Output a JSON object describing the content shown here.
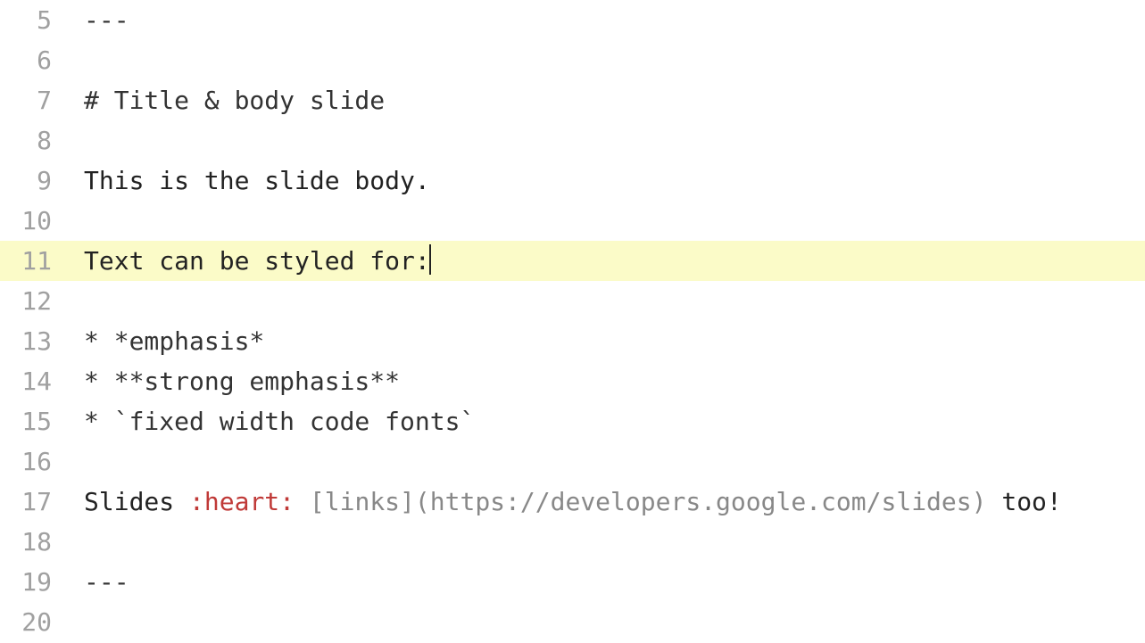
{
  "active_line_index": 6,
  "cursor_at": 6,
  "lines": [
    {
      "n": 5,
      "segs": [
        {
          "t": "---",
          "cls": "tk-punc"
        }
      ]
    },
    {
      "n": 6,
      "segs": []
    },
    {
      "n": 7,
      "segs": [
        {
          "t": "# Title & body slide",
          "cls": "tk-punc"
        }
      ]
    },
    {
      "n": 8,
      "segs": []
    },
    {
      "n": 9,
      "segs": [
        {
          "t": "This is the slide body.",
          "cls": ""
        }
      ]
    },
    {
      "n": 10,
      "segs": []
    },
    {
      "n": 11,
      "segs": [
        {
          "t": "Text can be styled for:",
          "cls": ""
        }
      ]
    },
    {
      "n": 12,
      "segs": []
    },
    {
      "n": 13,
      "segs": [
        {
          "t": "* *emphasis*",
          "cls": "tk-punc"
        }
      ]
    },
    {
      "n": 14,
      "segs": [
        {
          "t": "* **strong emphasis**",
          "cls": "tk-punc"
        }
      ]
    },
    {
      "n": 15,
      "segs": [
        {
          "t": "* `fixed width code fonts`",
          "cls": "tk-punc"
        }
      ]
    },
    {
      "n": 16,
      "segs": []
    },
    {
      "n": 17,
      "segs": [
        {
          "t": "Slides ",
          "cls": ""
        },
        {
          "t": ":heart:",
          "cls": "tk-emoji"
        },
        {
          "t": " ",
          "cls": ""
        },
        {
          "t": "[links](https://developers.google.com/slides)",
          "cls": "tk-link"
        },
        {
          "t": " too!",
          "cls": ""
        }
      ]
    },
    {
      "n": 18,
      "segs": []
    },
    {
      "n": 19,
      "segs": [
        {
          "t": "---",
          "cls": "tk-punc"
        }
      ]
    },
    {
      "n": 20,
      "segs": []
    }
  ]
}
